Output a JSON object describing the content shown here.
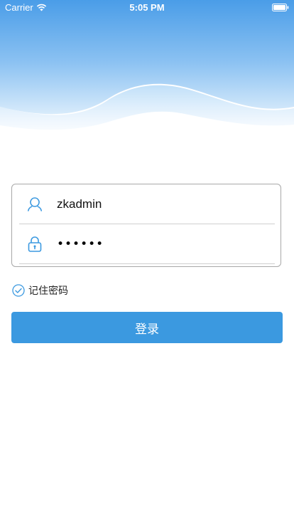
{
  "status_bar": {
    "carrier": "Carrier",
    "time": "5:05 PM"
  },
  "login": {
    "username_value": "zkadmin",
    "password_value": "••••••",
    "remember_label": "记住密码",
    "remember_checked": true,
    "login_button_label": "登录"
  },
  "icons": {
    "user": "user-icon",
    "lock": "lock-icon",
    "check": "check-circle-icon",
    "wifi": "wifi-icon",
    "battery": "battery-icon"
  },
  "colors": {
    "accent": "#3b99e0",
    "header_top": "#4c9fe8",
    "header_bottom": "#cfe6fa",
    "border": "#a8a8a8"
  }
}
